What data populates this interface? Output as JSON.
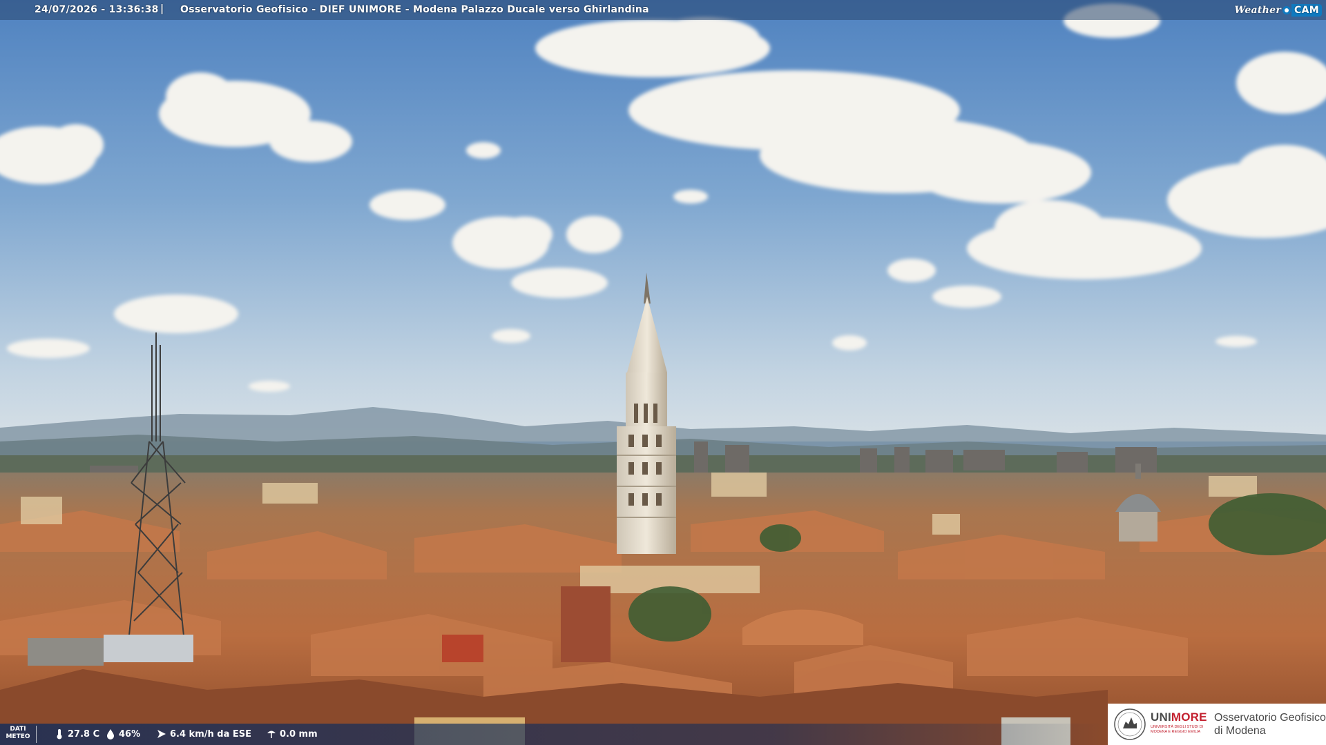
{
  "header": {
    "timestamp": "24/07/2026 - 13:36:38",
    "separator": "|",
    "caption": "Osservatorio Geofisico - DIEF UNIMORE - Modena Palazzo Ducale verso Ghirlandina",
    "brand_weather": "Weather",
    "brand_cam": "CAM"
  },
  "weather": {
    "label_line1": "DATI",
    "label_line2": "METEO",
    "temperature": "27.8 C",
    "humidity": "46%",
    "wind": "6.4 km/h da ESE",
    "rain": "0.0 mm"
  },
  "logo": {
    "uni_prefix": "UNI",
    "uni_suffix": "MORE",
    "uni_subtitle": "UNIVERSITÀ DEGLI STUDI DI MODENA E REGGIO EMILIA",
    "observatory_line1": "Osservatorio Geofisico",
    "observatory_line2": "di Modena"
  },
  "icons": [
    "thermometer-icon",
    "humidity-drop-icon",
    "wind-icon",
    "rain-gauge-icon",
    "university-seal-icon"
  ],
  "colors": {
    "sky_top": "#5b8cc4",
    "sky_horizon": "#c7d7e4",
    "roof": "#b86a3e",
    "accent_red": "#c3202f",
    "brand_blue": "#0f7ac0"
  }
}
